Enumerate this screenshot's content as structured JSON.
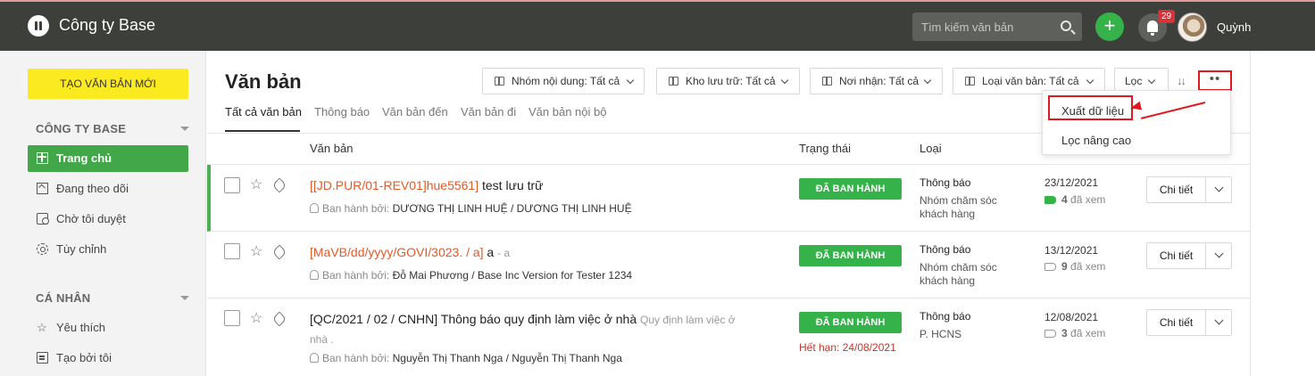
{
  "topbar": {
    "brand": "Công ty Base",
    "search_placeholder": "Tìm kiếm văn bản",
    "add_label": "+",
    "notification_count": "29",
    "username": "Quỳnh"
  },
  "sidebar": {
    "create_button": "TẠO VĂN BẢN MỚI",
    "section_company": "CÔNG TY BASE",
    "company_items": [
      {
        "label": "Trang chủ",
        "icon": "grid-icon",
        "active": true
      },
      {
        "label": "Đang theo dõi",
        "icon": "frame-icon"
      },
      {
        "label": "Chờ tôi duyệt",
        "icon": "pending-icon"
      },
      {
        "label": "Tùy chỉnh",
        "icon": "gear-icon"
      }
    ],
    "section_personal": "CÁ NHÂN",
    "personal_items": [
      {
        "label": "Yêu thích",
        "icon": "star-icon"
      },
      {
        "label": "Tạo bởi tôi",
        "icon": "document-icon"
      }
    ]
  },
  "main": {
    "title": "Văn bản",
    "filters": {
      "content_group": "Nhóm nội dung: Tất cả",
      "storage": "Kho lưu trữ: Tất cả",
      "recipient": "Nơi nhận: Tất cả",
      "doc_type": "Loại văn bản: Tất cả",
      "filter_label": "Lọc",
      "sort_label": "↓↓",
      "more_label": "••"
    },
    "tabs": [
      "Tất cả văn bản",
      "Thông báo",
      "Văn bản đến",
      "Văn bản đi",
      "Văn bản nội bộ"
    ],
    "dropdown": [
      "Xuất dữ liệu",
      "Lọc nâng cao"
    ],
    "columns": {
      "document": "Văn bản",
      "status": "Trạng thái",
      "type": "Loại"
    },
    "rows": [
      {
        "code": "[[JD.PUR/01-REV01]hue5561]",
        "title": "test lưu trữ",
        "excerpt": "",
        "issued_by_label": "Ban hành bởi:",
        "issued_by": "DƯƠNG THỊ LINH HUỆ / DƯƠNG THỊ LINH HUỆ",
        "status": "ĐÃ BAN HÀNH",
        "expire": "",
        "type": "Thông báo",
        "group": "Nhóm chăm sóc khách hàng",
        "date": "23/12/2021",
        "views_count": "4",
        "views_label": "đã xem",
        "detail": "Chi tiết"
      },
      {
        "code": "[MaVB/dd/yyyy/GOVI/3023. / a]",
        "title": "a",
        "excerpt": "- a",
        "issued_by_label": "Ban hành bởi:",
        "issued_by": "Đỗ Mai Phương / Base Inc Version for Tester 1234",
        "status": "ĐÃ BAN HÀNH",
        "expire": "",
        "type": "Thông báo",
        "group": "Nhóm chăm sóc khách hàng",
        "date": "13/12/2021",
        "views_count": "9",
        "views_label": "đã xem",
        "detail": "Chi tiết"
      },
      {
        "code": "",
        "title": "[QC/2021 / 02 / CNHN] Thông báo quy định làm việc ở nhà",
        "excerpt": "Quy định làm việc ở",
        "excerpt2": "nhà .",
        "issued_by_label": "Ban hành bởi:",
        "issued_by": "Nguyễn Thị Thanh Nga / Nguyễn Thị Thanh Nga",
        "status": "ĐÃ BAN HÀNH",
        "expire": "Hết hạn: 24/08/2021",
        "type": "Thông báo",
        "group": "P. HCNS",
        "date": "12/08/2021",
        "views_count": "3",
        "views_label": "đã xem",
        "detail": "Chi tiết"
      }
    ]
  },
  "colors": {
    "topbar": "#3d3f3b",
    "accent_green": "#35b34a",
    "create_yellow": "#fbea1f",
    "highlight_red": "#e0191f",
    "code_orange": "#e25a27"
  }
}
